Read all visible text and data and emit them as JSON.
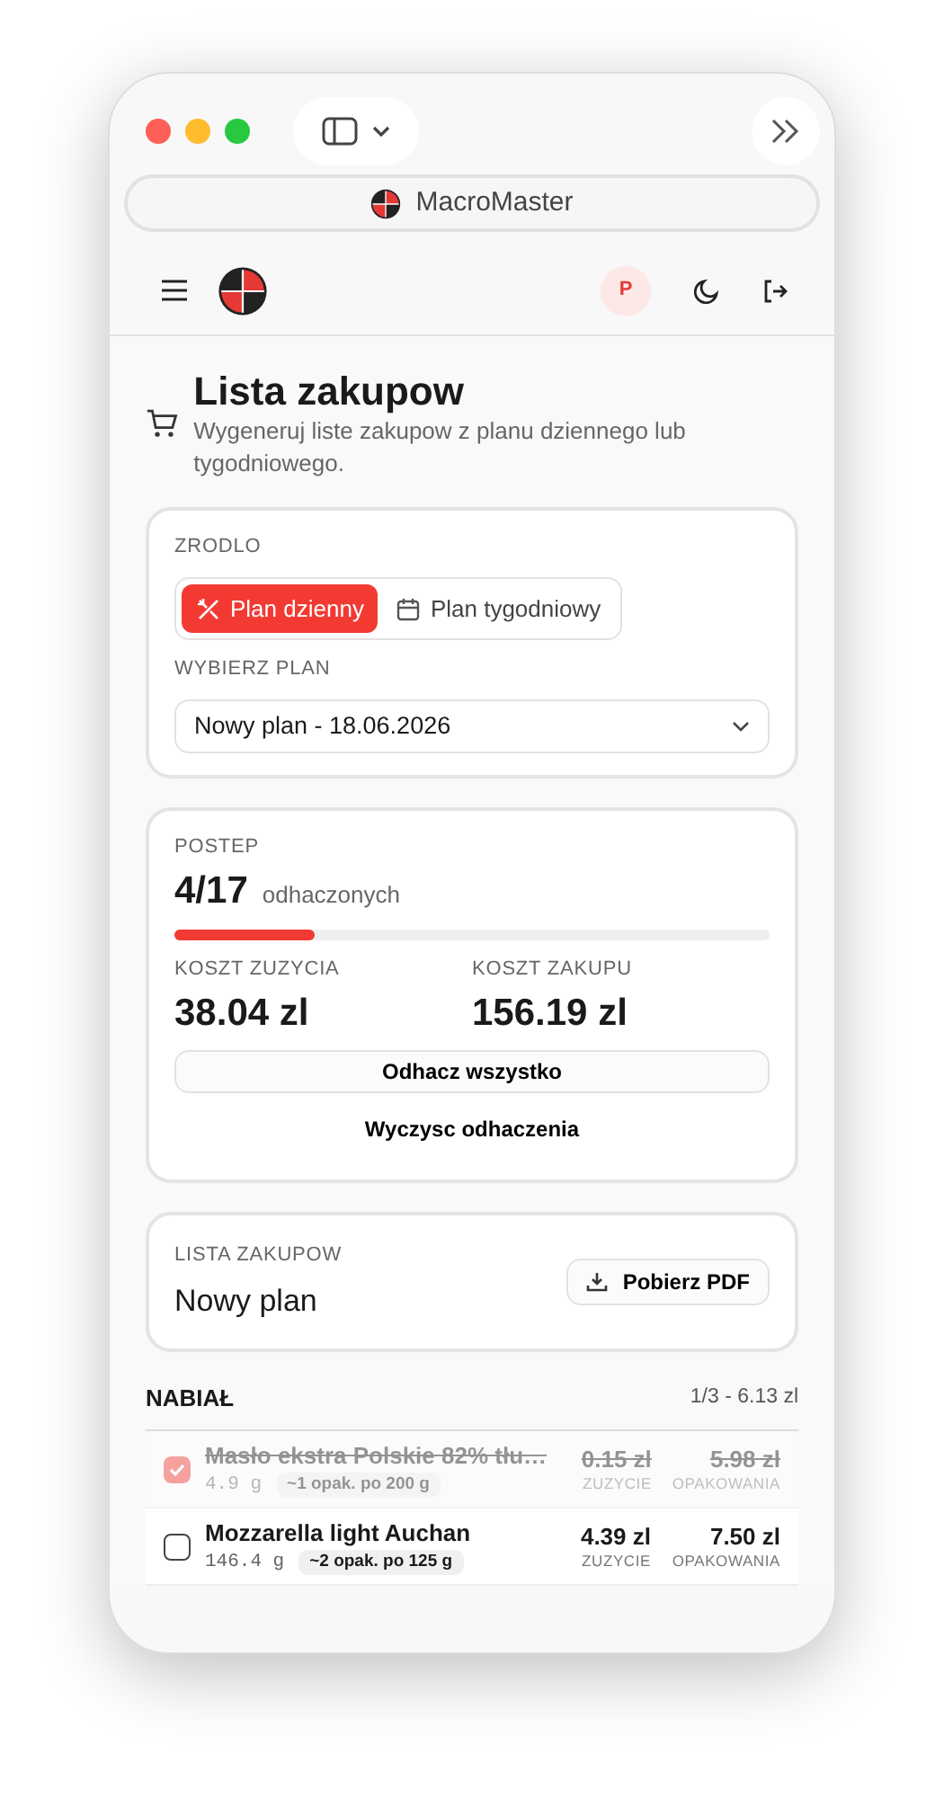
{
  "browser": {
    "title": "MacroMaster"
  },
  "header": {
    "avatar": "P"
  },
  "page": {
    "title": "Lista zakupow",
    "subtitle": "Wygeneruj liste zakupow z planu dziennego lub tygodniowego."
  },
  "source": {
    "label": "ZRODLO",
    "options": [
      {
        "label": "Plan dzienny",
        "kind": "daily",
        "selected": true
      },
      {
        "label": "Plan tygodniowy",
        "kind": "weekly",
        "selected": false
      }
    ],
    "plan_label": "WYBIERZ PLAN",
    "plan_value": "Nowy plan - 18.06.2026"
  },
  "progress": {
    "label": "POSTEP",
    "count": "4/17",
    "suffix": "odhaczonych",
    "level": 0.235,
    "costs": [
      {
        "label": "KOSZT ZUZYCIA",
        "value": "38.04 zl"
      },
      {
        "label": "KOSZT ZAKUPU",
        "value": "156.19 zl"
      }
    ],
    "check_all": "Odhacz wszystko",
    "clear": "Wyczysc odhaczenia"
  },
  "list": {
    "label": "LISTA ZAKUPOW",
    "name": "Nowy plan",
    "pdf_button": "Pobierz PDF"
  },
  "categories": [
    {
      "name": "NABIAŁ",
      "summary": "1/3 - 6.13 zl",
      "items": [
        {
          "name": "Masło ekstra Polskie 82% tłu…",
          "checked": true,
          "amount": "4.9 g",
          "pack": "~1 opak. po 200 g",
          "usage_cost": "0.15 zl",
          "usage_label": "ZUZYCIE",
          "pack_cost": "5.98 zl",
          "pack_label": "OPAKOWANIA"
        },
        {
          "name": "Mozzarella light Auchan",
          "checked": false,
          "amount": "146.4 g",
          "pack": "~2 opak. po 125 g",
          "usage_cost": "4.39 zl",
          "usage_label": "ZUZYCIE",
          "pack_cost": "7.50 zl",
          "pack_label": "OPAKOWANIA"
        }
      ]
    }
  ]
}
